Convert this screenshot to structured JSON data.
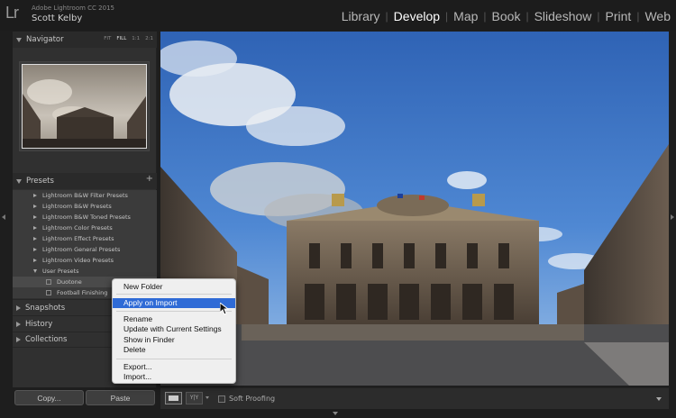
{
  "app": {
    "logo": "Lr",
    "title": "Adobe Lightroom CC 2015",
    "user": "Scott Kelby"
  },
  "modules": [
    {
      "label": "Library",
      "active": false
    },
    {
      "label": "Develop",
      "active": true
    },
    {
      "label": "Map",
      "active": false
    },
    {
      "label": "Book",
      "active": false
    },
    {
      "label": "Slideshow",
      "active": false
    },
    {
      "label": "Print",
      "active": false
    },
    {
      "label": "Web",
      "active": false
    }
  ],
  "module_separator": "|",
  "navigator": {
    "title": "Navigator",
    "zoom": [
      "FIT",
      "FILL",
      "1:1",
      "2:1"
    ],
    "zoom_selected": "FILL"
  },
  "presets": {
    "title": "Presets",
    "add_symbol": "+",
    "items": [
      {
        "label": "Lightroom B&W Filter Presets",
        "type": "folder",
        "expanded": false
      },
      {
        "label": "Lightroom B&W Presets",
        "type": "folder",
        "expanded": false
      },
      {
        "label": "Lightroom B&W Toned Presets",
        "type": "folder",
        "expanded": false
      },
      {
        "label": "Lightroom Color Presets",
        "type": "folder",
        "expanded": false
      },
      {
        "label": "Lightroom Effect Presets",
        "type": "folder",
        "expanded": false
      },
      {
        "label": "Lightroom General Presets",
        "type": "folder",
        "expanded": false
      },
      {
        "label": "Lightroom Video Presets",
        "type": "folder",
        "expanded": false
      },
      {
        "label": "User Presets",
        "type": "folder",
        "expanded": true
      },
      {
        "label": "Duotone",
        "type": "preset",
        "selected": true
      },
      {
        "label": "Football Finishing",
        "type": "preset",
        "selected": false
      }
    ]
  },
  "panels": {
    "snapshots": "Snapshots",
    "history": "History",
    "collections": "Collections"
  },
  "buttons": {
    "copy": "Copy...",
    "paste": "Paste"
  },
  "toolbar": {
    "compare_label": "Y|Y",
    "soft_proofing": "Soft Proofing",
    "soft_proofing_checked": false
  },
  "context_menu": {
    "items": [
      {
        "label": "New Folder",
        "highlighted": false
      },
      {
        "label": "Apply on Import",
        "highlighted": true
      },
      {
        "label": "Rename",
        "highlighted": false
      },
      {
        "label": "Update with Current Settings",
        "highlighted": false
      },
      {
        "label": "Show in Finder",
        "highlighted": false
      },
      {
        "label": "Delete",
        "highlighted": false
      },
      {
        "label": "Export...",
        "highlighted": false
      },
      {
        "label": "Import...",
        "highlighted": false
      }
    ]
  },
  "colors": {
    "menu_highlight": "#2f6bd6",
    "sky": "#3a6cc0",
    "panel_bg": "#303030"
  }
}
